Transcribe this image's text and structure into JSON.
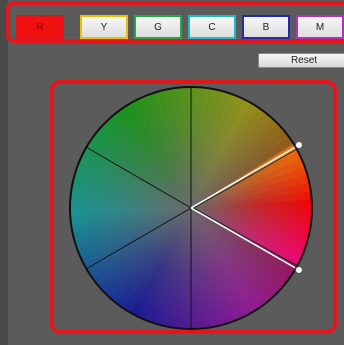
{
  "tabs": [
    {
      "label": "R",
      "border": "#e0141c",
      "bg": "#f01010",
      "text": "#8a0000",
      "selected": true
    },
    {
      "label": "Y",
      "border": "#e2c400",
      "bg": "",
      "text": "#222222",
      "selected": false
    },
    {
      "label": "G",
      "border": "#22aa44",
      "bg": "",
      "text": "#222222",
      "selected": false
    },
    {
      "label": "C",
      "border": "#22b8c6",
      "bg": "",
      "text": "#222222",
      "selected": false
    },
    {
      "label": "B",
      "border": "#1c2bb0",
      "bg": "",
      "text": "#222222",
      "selected": false
    },
    {
      "label": "M",
      "border": "#b030c0",
      "bg": "",
      "text": "#222222",
      "selected": false
    }
  ],
  "reset_label": "Reset",
  "colors": {
    "highlight_frame": "#e8141c",
    "background": "#5b5b5b"
  },
  "wheel": {
    "selected_hue": "red",
    "icons": [
      "hue-wheel",
      "range-handle-upper",
      "range-handle-lower"
    ]
  }
}
